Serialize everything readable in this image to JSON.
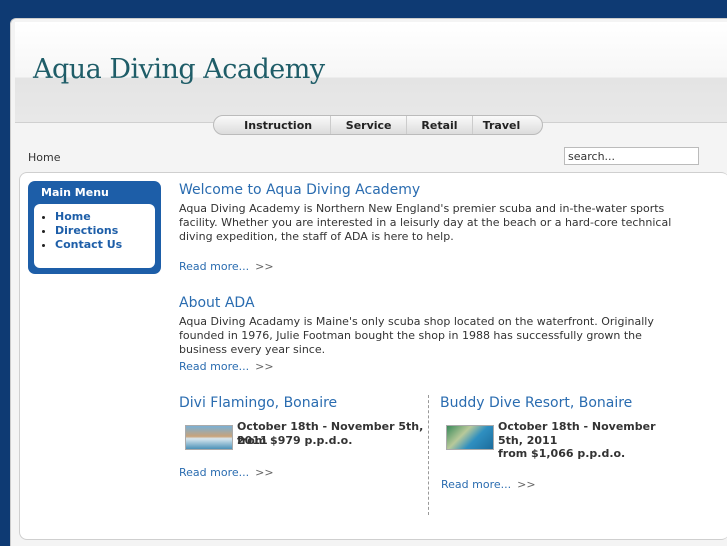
{
  "site": {
    "title": "Aqua Diving Academy"
  },
  "nav": [
    {
      "label": "Instruction"
    },
    {
      "label": "Service"
    },
    {
      "label": "Retail"
    },
    {
      "label": "Travel"
    }
  ],
  "breadcrumb": "Home",
  "search": {
    "value": "search..."
  },
  "menu": {
    "title": "Main Menu",
    "items": [
      {
        "label": "Home"
      },
      {
        "label": "Directions"
      },
      {
        "label": "Contact Us"
      }
    ]
  },
  "articles": {
    "welcome": {
      "title": "Welcome to Aqua Diving Academy",
      "body": "Aqua Diving Academy is Northern New England's premier scuba and in-the-water sports facility. Whether you are interested in a leisurly day at the beach or a hard-core technical diving expedition, the staff of ADA is here to help.",
      "more": "Read more...",
      "arrows": ">>"
    },
    "about": {
      "title": "About ADA",
      "body": "Aqua Diving Acadamy is Maine's only scuba shop located on the waterfront. Originally founded in 1976, Julie Footman bought the shop in 1988 has successfully grown the business every year since.",
      "more": "Read more...",
      "arrows": ">>"
    },
    "trip1": {
      "title": "Divi Flamingo, Bonaire",
      "dates": "October 18th - November 5th, 2011",
      "price": "from $979 p.p.d.o.",
      "more": "Read more...",
      "arrows": ">>"
    },
    "trip2": {
      "title": "Buddy Dive Resort, Bonaire",
      "dates": "October 18th - November 5th, 2011",
      "price": "from $1,066 p.p.d.o.",
      "more": "Read more...",
      "arrows": ">>"
    }
  }
}
